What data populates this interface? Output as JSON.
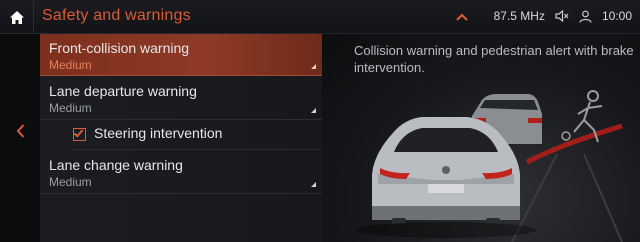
{
  "header": {
    "title": "Safety and warnings",
    "radio": "87.5 MHz",
    "time": "10:00"
  },
  "list": {
    "items": [
      {
        "label": "Front-collision warning",
        "value": "Medium",
        "selected": true
      },
      {
        "label": "Lane departure warning",
        "value": "Medium",
        "selected": false
      },
      {
        "label": "Lane change warning",
        "value": "Medium",
        "selected": false
      }
    ],
    "sub_item": {
      "label": "Steering intervention",
      "checked": true
    }
  },
  "info": {
    "description": "Collision warning and pedestrian alert with brake intervention."
  },
  "colors": {
    "accent": "#d95b37",
    "selected_bg": "#8e3a26",
    "text": "#e6e8ec",
    "secondary_text": "#9a9da3"
  },
  "icons": {
    "home": "home-icon",
    "back": "chevron-left-icon",
    "expand": "chevron-up-icon",
    "mute": "speaker-muted-icon",
    "user": "user-icon"
  }
}
